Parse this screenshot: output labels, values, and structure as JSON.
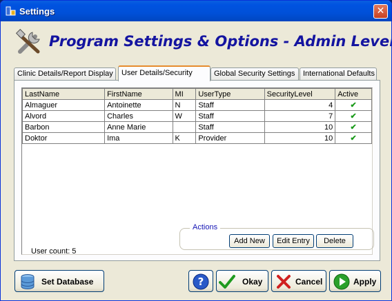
{
  "window": {
    "title": "Settings"
  },
  "header": {
    "title": "Program Settings & Options - Admin Level"
  },
  "tabs": [
    {
      "label": "Clinic Details/Report Display",
      "active": false
    },
    {
      "label": "User Details/Security",
      "active": true
    },
    {
      "label": "Global Security Settings",
      "active": false
    },
    {
      "label": "International Defaults",
      "active": false
    }
  ],
  "users_table": {
    "columns": [
      "LastName",
      "FirstName",
      "MI",
      "UserType",
      "SecurityLevel",
      "Active"
    ],
    "rows": [
      {
        "last": "Almaguer",
        "first": "Antoinette",
        "mi": "N",
        "type": "Staff",
        "level": "4",
        "active": true
      },
      {
        "last": "Alvord",
        "first": "Charles",
        "mi": "W",
        "type": "Staff",
        "level": "7",
        "active": true
      },
      {
        "last": "Barbon",
        "first": "Anne Marie",
        "mi": "",
        "type": "Staff",
        "level": "10",
        "active": true
      },
      {
        "last": "Doktor",
        "first": "Ima",
        "mi": "K",
        "type": "Provider",
        "level": "10",
        "active": true
      }
    ]
  },
  "user_count": "User count: 5",
  "actions": {
    "legend": "Actions",
    "add_new": "Add New",
    "edit_entry": "Edit Entry",
    "delete": "Delete"
  },
  "buttons": {
    "set_database": "Set Database",
    "okay": "Okay",
    "cancel": "Cancel",
    "apply": "Apply"
  },
  "icons": {
    "app": "settings-app-icon",
    "close": "close-icon",
    "tools": "tools-icon",
    "database": "database-icon",
    "help": "help-icon",
    "check": "check-icon",
    "cancel": "x-icon",
    "apply": "play-arrow-icon"
  },
  "colors": {
    "title_text": "#1414a0",
    "check": "#1a9a1a",
    "active_tab_accent": "#e68b2c",
    "titlebar": "#0050d8"
  }
}
